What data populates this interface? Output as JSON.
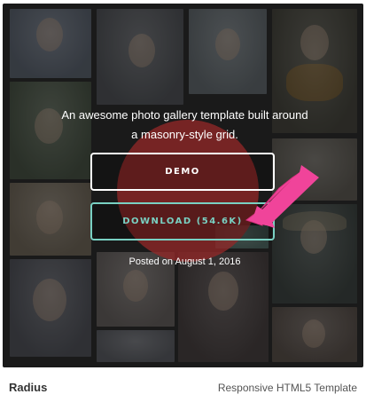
{
  "gallery": {
    "tagline_line1": "An awesome photo gallery template built around",
    "tagline_line2": "a masonry-style grid.",
    "demo_label": "DEMO",
    "download_label": "DOWNLOAD (54.6K)",
    "posted_date": "Posted on August 1, 2016",
    "accent_color": "#79d1c3",
    "arrow_color": "#f0449a"
  },
  "footer": {
    "template_name": "Radius",
    "template_type": "Responsive HTML5 Template"
  }
}
